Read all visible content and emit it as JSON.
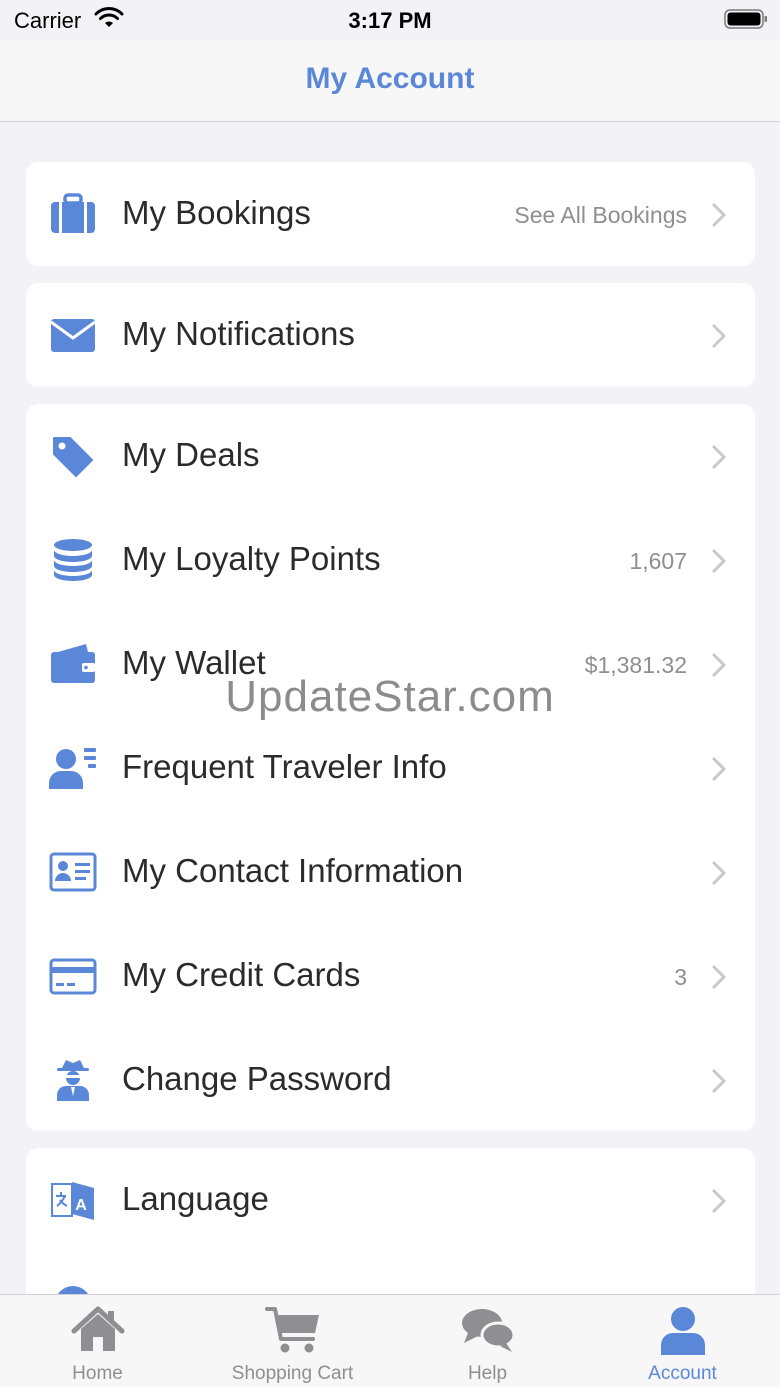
{
  "status_bar": {
    "carrier": "Carrier",
    "time": "3:17 PM"
  },
  "nav": {
    "title": "My Account"
  },
  "groups": {
    "bookings": {
      "label": "My Bookings",
      "detail": "See All Bookings"
    },
    "notifications": {
      "label": "My Notifications"
    },
    "deals": {
      "label": "My Deals"
    },
    "loyalty": {
      "label": "My Loyalty Points",
      "detail": "1,607"
    },
    "wallet": {
      "label": "My Wallet",
      "detail": "$1,381.32"
    },
    "traveler": {
      "label": "Frequent Traveler Info"
    },
    "contact": {
      "label": "My Contact Information"
    },
    "cards": {
      "label": "My Credit Cards",
      "detail": "3"
    },
    "password": {
      "label": "Change Password"
    },
    "language": {
      "label": "Language"
    }
  },
  "watermark": "UpdateStar.com",
  "tabs": [
    {
      "label": "Home",
      "icon": "home-icon"
    },
    {
      "label": "Shopping Cart",
      "icon": "cart-icon"
    },
    {
      "label": "Help",
      "icon": "chat-bubbles-icon"
    },
    {
      "label": "Account",
      "icon": "person-icon"
    }
  ],
  "colors": {
    "accent": "#5b87d9",
    "inactive": "#8e8e93",
    "background": "#f2f2f7"
  }
}
